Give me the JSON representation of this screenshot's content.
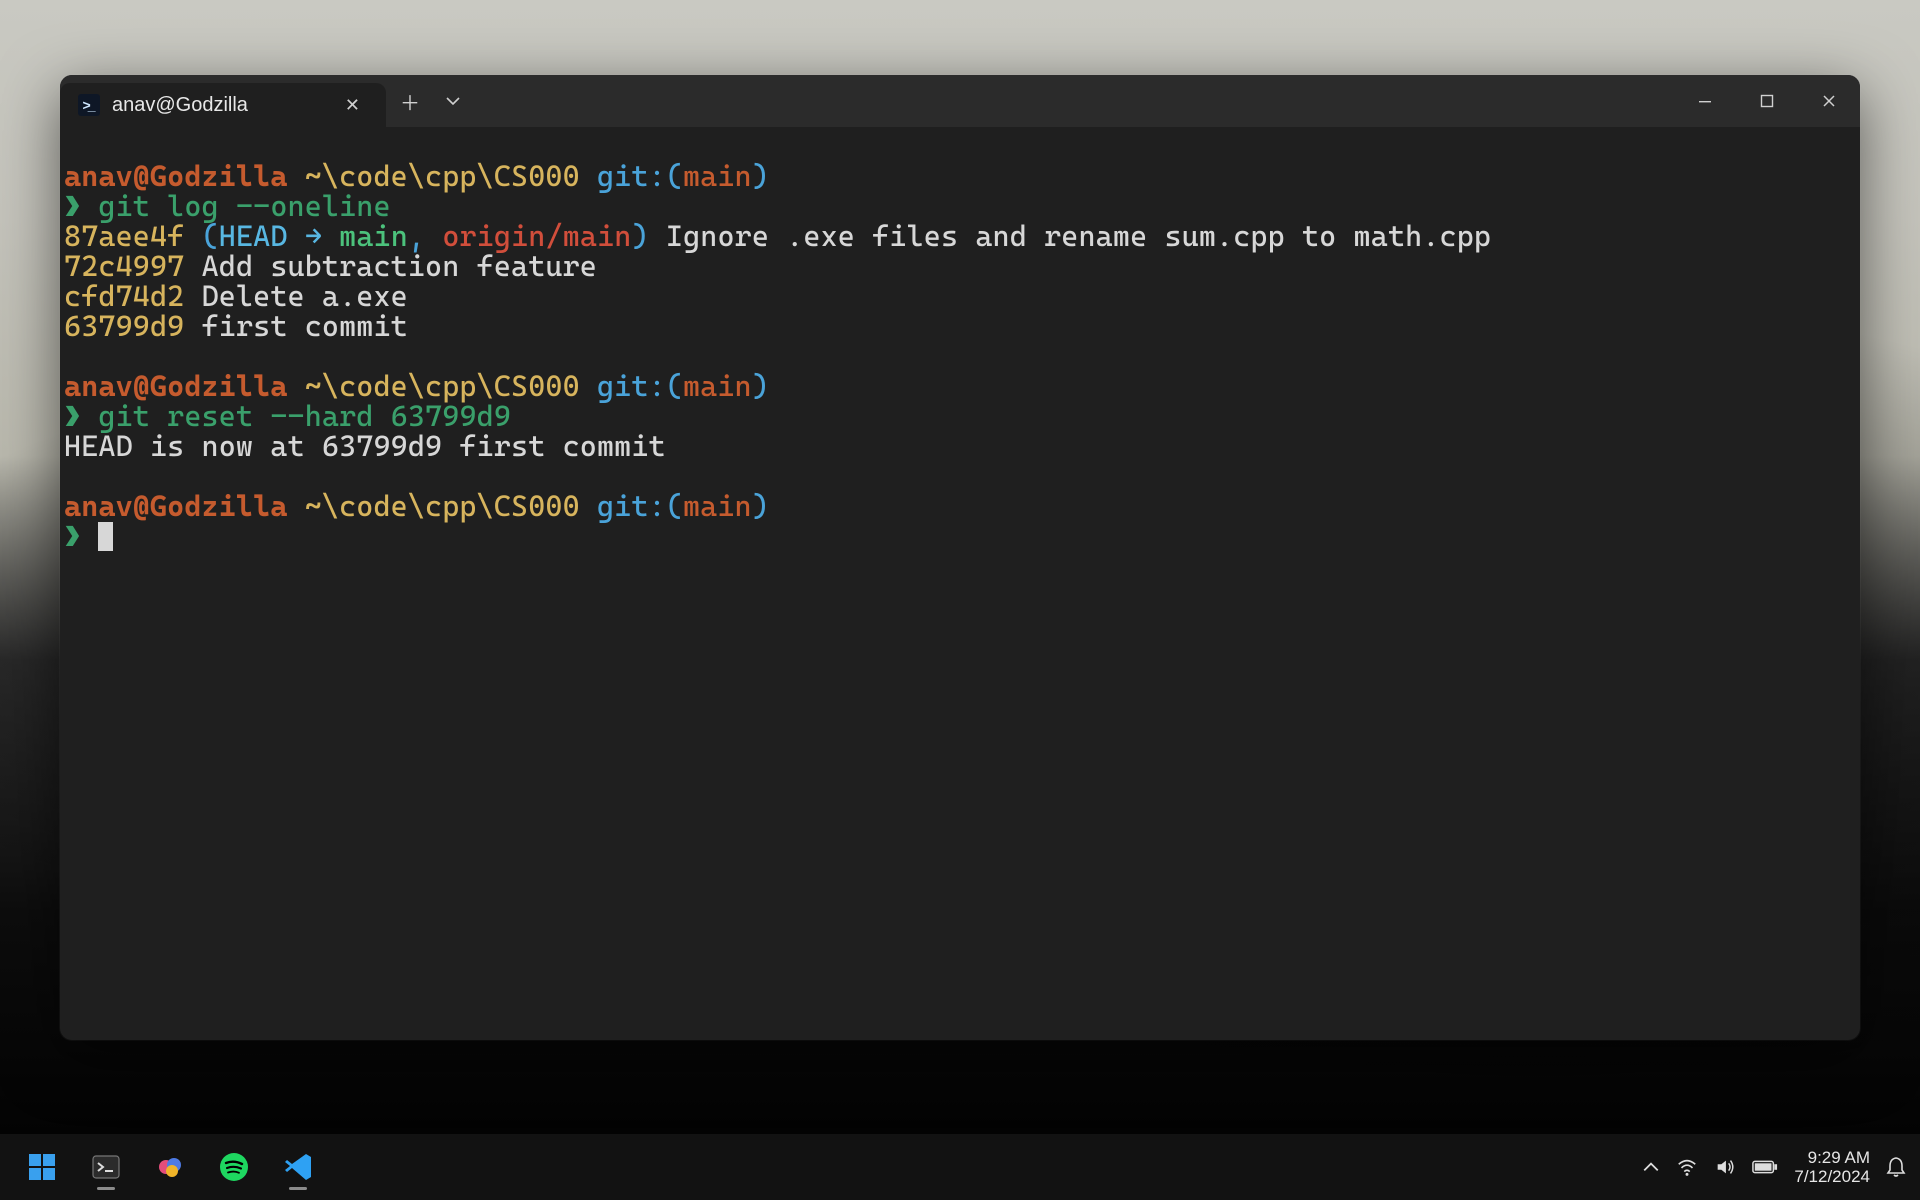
{
  "window": {
    "title": "anav@Godzilla",
    "tab_label": "anav@Godzilla"
  },
  "prompt": {
    "user_host": "anav@Godzilla",
    "path": "~\\code\\cpp\\CS000",
    "git_prefix": "git:",
    "branch": "main",
    "symbol": "❯"
  },
  "commands": {
    "log": "git log --oneline",
    "reset": "git reset --hard 63799d9"
  },
  "commits": [
    {
      "hash": "87aee4f",
      "refs": {
        "head": "HEAD",
        "arrow": "→",
        "local": "main",
        "remote": "origin/main"
      },
      "message": "Ignore .exe files and rename sum.cpp to math.cpp"
    },
    {
      "hash": "72c4997",
      "message": "Add subtraction feature"
    },
    {
      "hash": "cfd74d2",
      "message": "Delete a.exe"
    },
    {
      "hash": "63799d9",
      "message": "first commit"
    }
  ],
  "reset_output": "HEAD is now at 63799d9 first commit",
  "taskbar": {
    "apps": [
      "start",
      "terminal",
      "copilot",
      "spotify",
      "vscode"
    ],
    "clock_time": "9:29 AM",
    "clock_date": "7/12/2024"
  },
  "colors": {
    "userhost": "#c55b2e",
    "path": "#d7b45d",
    "gitlabel": "#4aa3d9",
    "prompt": "#3aa06b",
    "head": "#58b7e2",
    "local": "#4cc27c",
    "remote": "#d14e3b"
  }
}
